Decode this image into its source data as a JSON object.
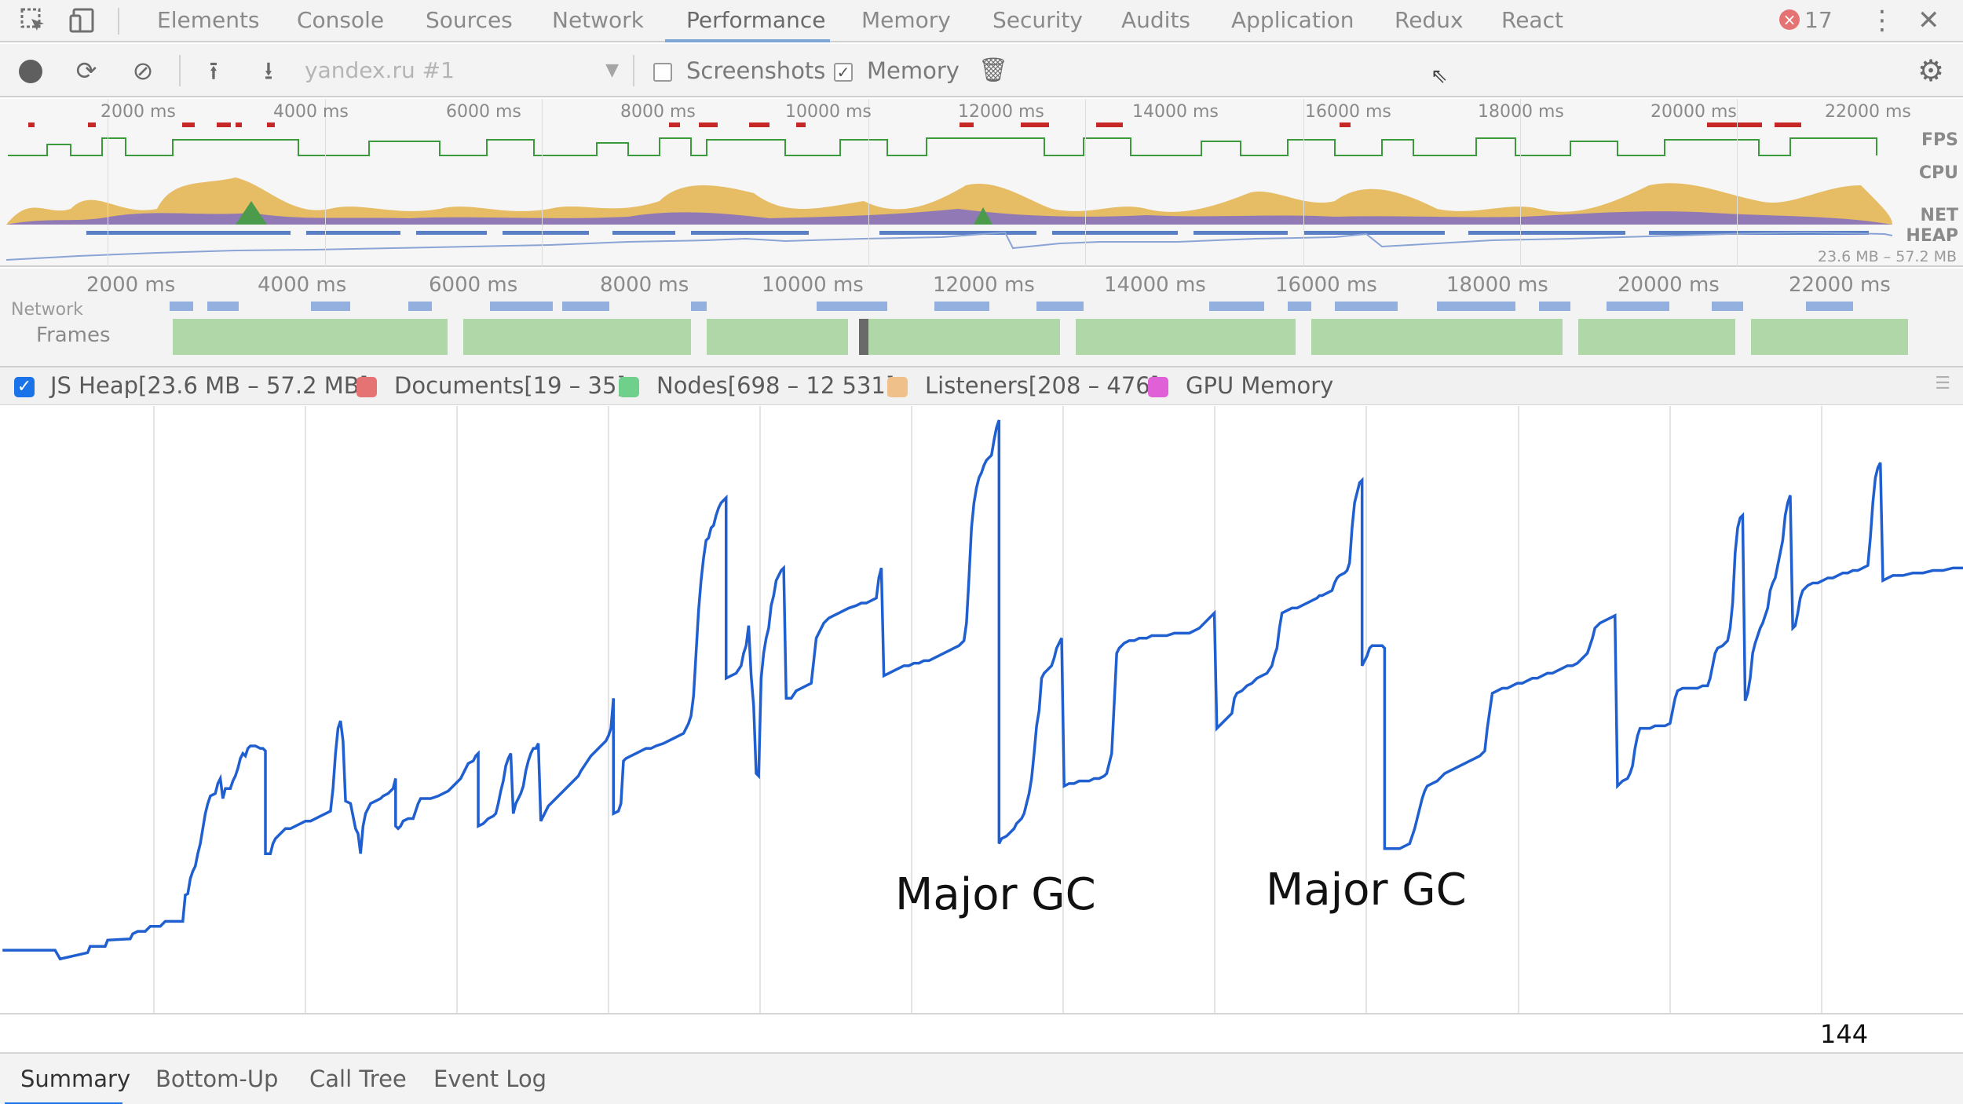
{
  "tabs": {
    "items": [
      "Elements",
      "Console",
      "Sources",
      "Network",
      "Performance",
      "Memory",
      "Security",
      "Audits",
      "Application",
      "Redux",
      "React"
    ],
    "active": "Performance",
    "error_count": "17"
  },
  "toolbar": {
    "profile": "yandex.ru #1",
    "screenshots_label": "Screenshots",
    "screenshots_checked": false,
    "memory_label": "Memory",
    "memory_checked": true
  },
  "overview": {
    "ticks": [
      "2000 ms",
      "4000 ms",
      "6000 ms",
      "8000 ms",
      "10000 ms",
      "12000 ms",
      "14000 ms",
      "16000 ms",
      "18000 ms",
      "20000 ms",
      "22000 ms"
    ],
    "lanes": [
      "FPS",
      "CPU",
      "NET",
      "HEAP"
    ],
    "heap_range": "23.6 MB – 57.2 MB"
  },
  "timeline": {
    "ticks": [
      "2000 ms",
      "4000 ms",
      "6000 ms",
      "8000 ms",
      "10000 ms",
      "12000 ms",
      "14000 ms",
      "16000 ms",
      "18000 ms",
      "20000 ms",
      "22000 ms"
    ],
    "network_label": "Network",
    "frames_label": "Frames"
  },
  "counters": {
    "js_heap": "JS Heap[23.6 MB – 57.2 MB]",
    "documents": "Documents[19 – 35]",
    "nodes": "Nodes[698 – 12 531]",
    "listeners": "Listeners[208 – 476]",
    "gpu": "GPU Memory"
  },
  "colors": {
    "heap_line": "#1f5fd0",
    "documents": "#e57373",
    "nodes": "#6fd08c",
    "listeners": "#f0c08a",
    "gpu": "#e060d8",
    "accent": "#1a73e8"
  },
  "annotations": [
    "Major GC",
    "Major GC"
  ],
  "bottom_value": "144",
  "bottom_tabs": {
    "items": [
      "Summary",
      "Bottom-Up",
      "Call Tree",
      "Event Log"
    ],
    "active": "Summary"
  }
}
